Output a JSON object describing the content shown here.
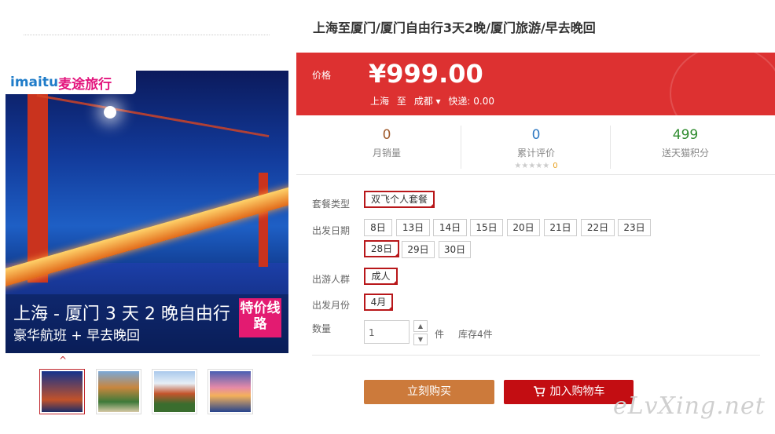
{
  "product": {
    "title": "上海至厦门/厦门自由行3天2晚/厦门旅游/早去晚回",
    "image": {
      "brand_prefix": "imaitu",
      "brand_name": "麦途旅行",
      "caption_line1": "上海 - 厦门  3 天 2 晚自由行",
      "caption_line2": "豪华航班 + 早去晚回",
      "badge": "特价线路"
    },
    "thumb_arrow": "^"
  },
  "price": {
    "label": "价格",
    "value": "¥999.00",
    "from": "上海",
    "to_word": "至",
    "destination": "成都",
    "shipping": "快递: 0.00"
  },
  "stats": [
    {
      "value": "0",
      "label": "月销量",
      "color": "#a05a2c"
    },
    {
      "value": "0",
      "label": "累计评价",
      "color": "#2f79c2",
      "stars": "★★★★★",
      "rating": "0"
    },
    {
      "value": "499",
      "label": "送天猫积分",
      "color": "#2e8b2e"
    }
  ],
  "options": {
    "package": {
      "label": "套餐类型",
      "items": [
        "双飞个人套餐"
      ],
      "selected": 0
    },
    "date": {
      "label": "出发日期",
      "items": [
        "8日",
        "13日",
        "14日",
        "15日",
        "20日",
        "21日",
        "22日",
        "23日",
        "28日",
        "29日",
        "30日"
      ],
      "selected": 8
    },
    "group": {
      "label": "出游人群",
      "items": [
        "成人"
      ],
      "selected": 0
    },
    "month": {
      "label": "出发月份",
      "items": [
        "4月"
      ],
      "selected": 0
    }
  },
  "quantity": {
    "label": "数量",
    "value": "1",
    "unit": "件",
    "stock": "库存4件",
    "up": "▲",
    "down": "▼"
  },
  "buttons": {
    "buy": "立刻购买",
    "cart": "加入购物车"
  },
  "watermark": "eLvXing.net",
  "colors": {
    "price_bg": "#dd3131",
    "buy": "#cc7a3b",
    "cart": "#c30d12",
    "selected_border": "#b8171a"
  }
}
